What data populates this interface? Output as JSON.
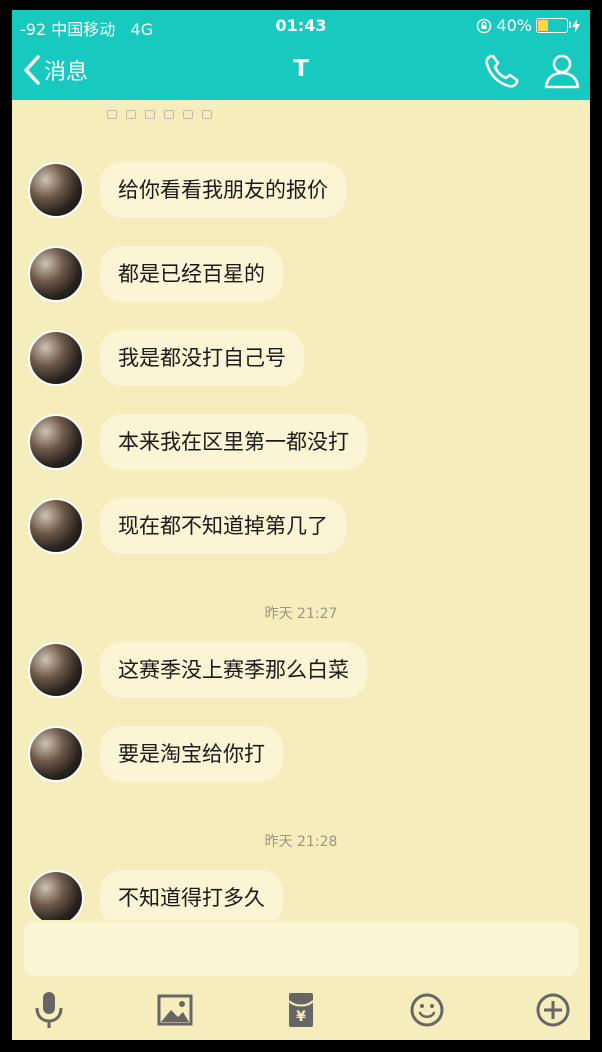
{
  "status": {
    "signal": "-92",
    "carrier": "中国移动",
    "network": "4G",
    "time": "01:43",
    "battery_percent": "40%",
    "battery_level": 0.4
  },
  "nav": {
    "back_label": "消息",
    "title": "T"
  },
  "messages": [
    {
      "text": "给你看看我朋友的报价"
    },
    {
      "text": "都是已经百星的"
    },
    {
      "text": "我是都没打自己号"
    },
    {
      "text": "本来我在区里第一都没打"
    },
    {
      "text": "现在都不知道掉第几了"
    },
    {
      "text": "这赛季没上赛季那么白菜"
    },
    {
      "text": "要是淘宝给你打"
    },
    {
      "text": "不知道得打多久"
    }
  ],
  "timestamps": [
    "昨天 21:27",
    "昨天 21:28"
  ],
  "icons": {
    "back": "chevron-left-icon",
    "call": "phone-icon",
    "profile": "person-icon",
    "voice": "microphone-icon",
    "image": "image-icon",
    "red_packet": "red-packet-icon",
    "emoji": "emoji-icon",
    "more": "plus-circle-icon"
  },
  "colors": {
    "accent": "#17c9be",
    "background": "#f6edbd",
    "bubble": "#fbf5d5"
  }
}
